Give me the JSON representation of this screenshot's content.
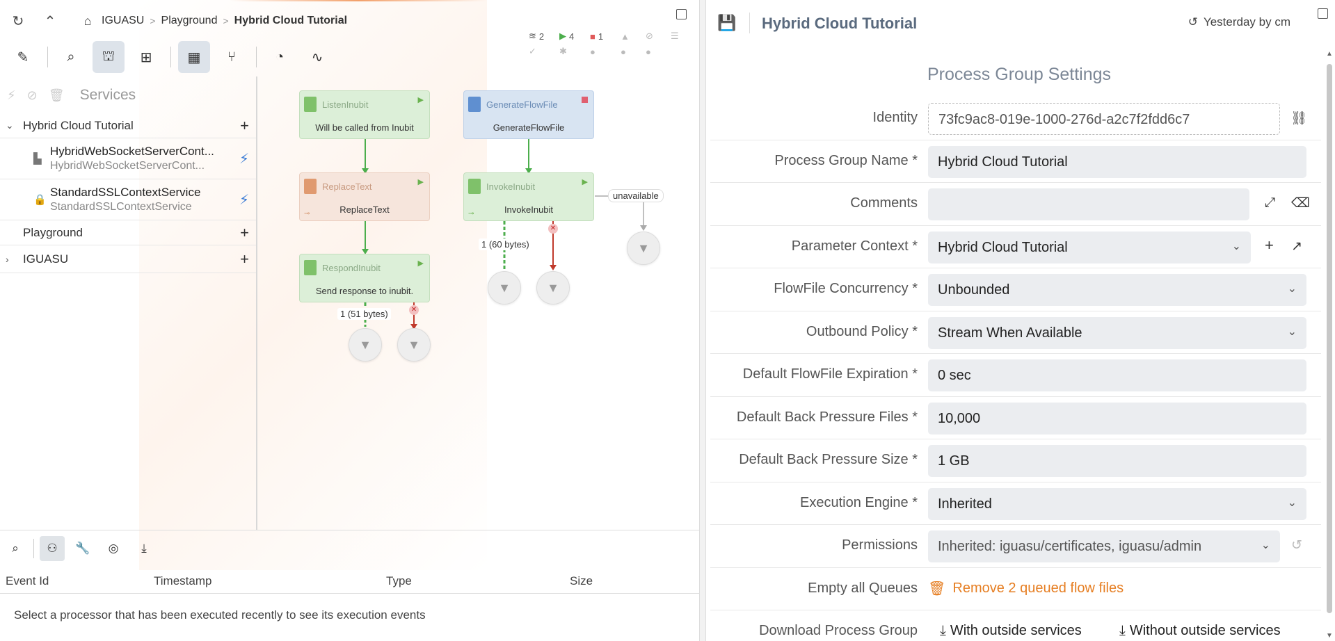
{
  "breadcrumb": {
    "root": "IGUASU",
    "parent": "Playground",
    "current": "Hybrid Cloud Tutorial"
  },
  "stats": {
    "groups": "2",
    "running": "4",
    "stopped": "1"
  },
  "services_panel": {
    "title": "Services",
    "tree": [
      {
        "label": "Hybrid Cloud Tutorial",
        "expanded": true
      },
      {
        "label": "Playground"
      },
      {
        "label": "IGUASU",
        "expanded": false
      }
    ],
    "services": [
      {
        "name": "HybridWebSocketServerCont...",
        "type": "HybridWebSocketServerCont..."
      },
      {
        "name": "StandardSSLContextService",
        "type": "StandardSSLContextService"
      }
    ]
  },
  "canvas": {
    "nodes": {
      "listen": {
        "title": "ListenInubit",
        "body": "Will be called from Inubit"
      },
      "replace": {
        "title": "ReplaceText",
        "body": "ReplaceText"
      },
      "respond": {
        "title": "RespondInubit",
        "body": "Send response to inubit."
      },
      "generate": {
        "title": "GenerateFlowFile",
        "body": "GenerateFlowFile"
      },
      "invoke": {
        "title": "InvokeInubit",
        "body": "InvokeInubit"
      }
    },
    "queues": {
      "respond_success": "1 (51 bytes)",
      "invoke_response": "1 (60 bytes)",
      "unavailable": "unavailable"
    }
  },
  "events": {
    "columns": {
      "event_id": "Event Id",
      "timestamp": "Timestamp",
      "type": "Type",
      "size": "Size"
    },
    "empty_message": "Select a processor that has been executed recently to see its execution events"
  },
  "settings": {
    "header_title": "Hybrid Cloud Tutorial",
    "history": "Yesterday by cm",
    "section_title": "Process Group Settings",
    "fields": {
      "identity": {
        "label": "Identity",
        "value": "73fc9ac8-019e-1000-276d-a2c7f2fdd6c7"
      },
      "name": {
        "label": "Process Group Name *",
        "value": "Hybrid Cloud Tutorial"
      },
      "comments": {
        "label": "Comments",
        "value": ""
      },
      "param_context": {
        "label": "Parameter Context *",
        "value": "Hybrid Cloud Tutorial"
      },
      "concurrency": {
        "label": "FlowFile Concurrency *",
        "value": "Unbounded"
      },
      "outbound": {
        "label": "Outbound Policy *",
        "value": "Stream When Available"
      },
      "expiration": {
        "label": "Default FlowFile Expiration *",
        "value": "0 sec"
      },
      "bp_files": {
        "label": "Default Back Pressure Files *",
        "value": "10,000"
      },
      "bp_size": {
        "label": "Default Back Pressure Size *",
        "value": "1 GB"
      },
      "engine": {
        "label": "Execution Engine *",
        "value": "Inherited"
      },
      "permissions": {
        "label": "Permissions",
        "value": "Inherited: iguasu/certificates, iguasu/admin"
      },
      "empty_queues": {
        "label": "Empty all Queues",
        "value": "Remove 2 queued flow files"
      },
      "download": {
        "label": "Download Process Group",
        "with": "With outside services",
        "without": "Without outside services"
      }
    }
  },
  "colors": {
    "accent_green": "#4cae4c",
    "stop_red": "#e05a5a",
    "warn_orange": "#e67e22",
    "bolt_blue": "#3a7bd5"
  }
}
